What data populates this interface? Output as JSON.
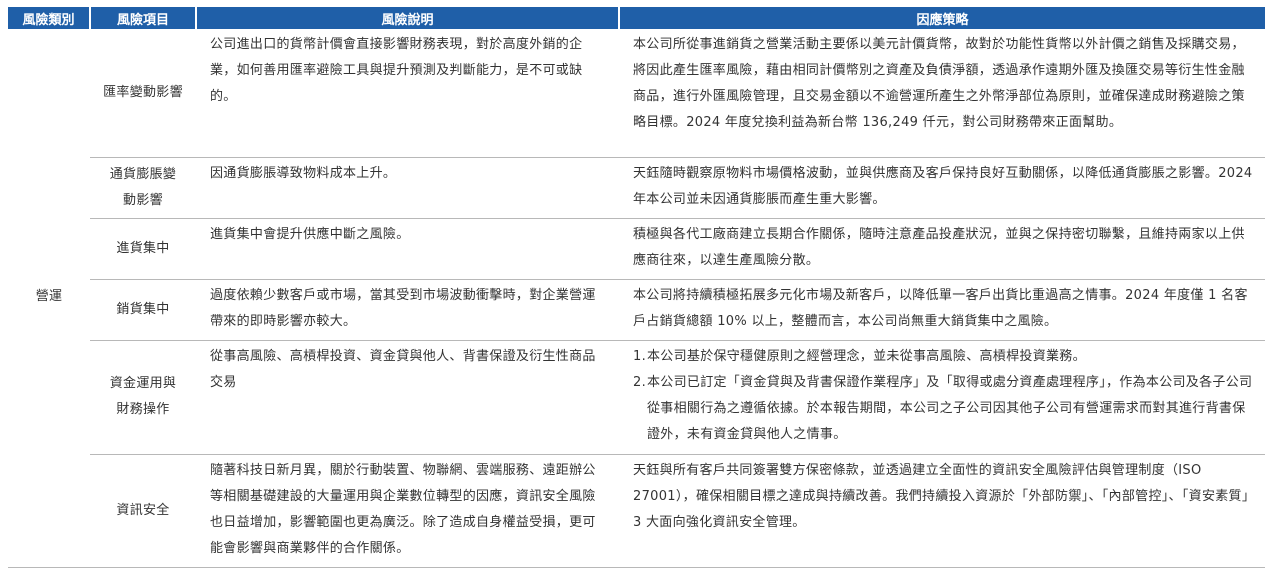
{
  "headers": [
    "風險類別",
    "風險項目",
    "風險說明",
    "因應策略"
  ],
  "category": "營運",
  "rows": [
    {
      "item": "匯率變動影響",
      "desc": "公司進出口的貨幣計價會直接影響財務表現，對於高度外銷的企業，如何善用匯率避險工具與提升預測及判斷能力，是不可或缺的。",
      "strategy": "本公司所從事進銷貨之營業活動主要係以美元計價貨幣，故對於功能性貨幣以外計價之銷售及採購交易，將因此產生匯率風險，藉由相同計價幣別之資產及負債淨額，透過承作遠期外匯及換匯交易等衍生性金融商品，進行外匯風險管理，且交易金額以不逾營運所產生之外幣淨部位為原則，並確保達成財務避險之策略目標。2024 年度兌換利益為新台幣 136,249 仟元，對公司財務帶來正面幫助。"
    },
    {
      "item": "通貨膨脹變動影響",
      "desc": "因通貨膨脹導致物料成本上升。",
      "strategy": "天鈺隨時觀察原物料市場價格波動，並與供應商及客戶保持良好互動關係，以降低通貨膨脹之影響。2024 年本公司並未因通貨膨脹而產生重大影響。"
    },
    {
      "item": "進貨集中",
      "desc": "進貨集中會提升供應中斷之風險。",
      "strategy": "積極與各代工廠商建立長期合作關係，隨時注意產品投產狀況，並與之保持密切聯繫，且維持兩家以上供應商往來，以達生產風險分散。"
    },
    {
      "item": "銷貨集中",
      "desc": "過度依賴少數客戶或市場，當其受到市場波動衝擊時，對企業營運帶來的即時影響亦較大。",
      "strategy": "本公司將持續積極拓展多元化市場及新客戶，以降低單一客戶出貨比重過高之情事。2024 年度僅 1 名客戶占銷貨總額 10% 以上，整體而言，本公司尚無重大銷貨集中之風險。"
    },
    {
      "item": "資金運用與財務操作",
      "desc": "從事高風險、高槓桿投資、資金貸與他人、背書保證及衍生性商品交易",
      "strategy_list": [
        {
          "n": "1.",
          "text": "本公司基於保守穩健原則之經營理念，並未從事高風險、高槓桿投資業務。"
        },
        {
          "n": "2.",
          "text": "本公司已訂定「資金貸與及背書保證作業程序」及「取得或處分資產處理程序」，作為本公司及各子公司從事相關行為之遵循依據。於本報告期間，本公司之子公司因其他子公司有營運需求而對其進行背書保證外，未有資金貸與他人之情事。"
        }
      ]
    },
    {
      "item": "資訊安全",
      "desc": "隨著科技日新月異，關於行動裝置、物聯網、雲端服務、遠距辦公等相關基礎建設的大量運用與企業數位轉型的因應，資訊安全風險也日益增加，影響範圍也更為廣泛。除了造成自身權益受損，更可能會影響與商業夥伴的合作關係。",
      "strategy": "天鈺與所有客戶共同簽署雙方保密條款，並透過建立全面性的資訊安全風險評估與管理制度（ISO 27001），確保相關目標之達成與持續改善。我們持續投入資源於「外部防禦」、「內部管控」、「資安素質」3 大面向強化資訊安全管理。"
    }
  ]
}
